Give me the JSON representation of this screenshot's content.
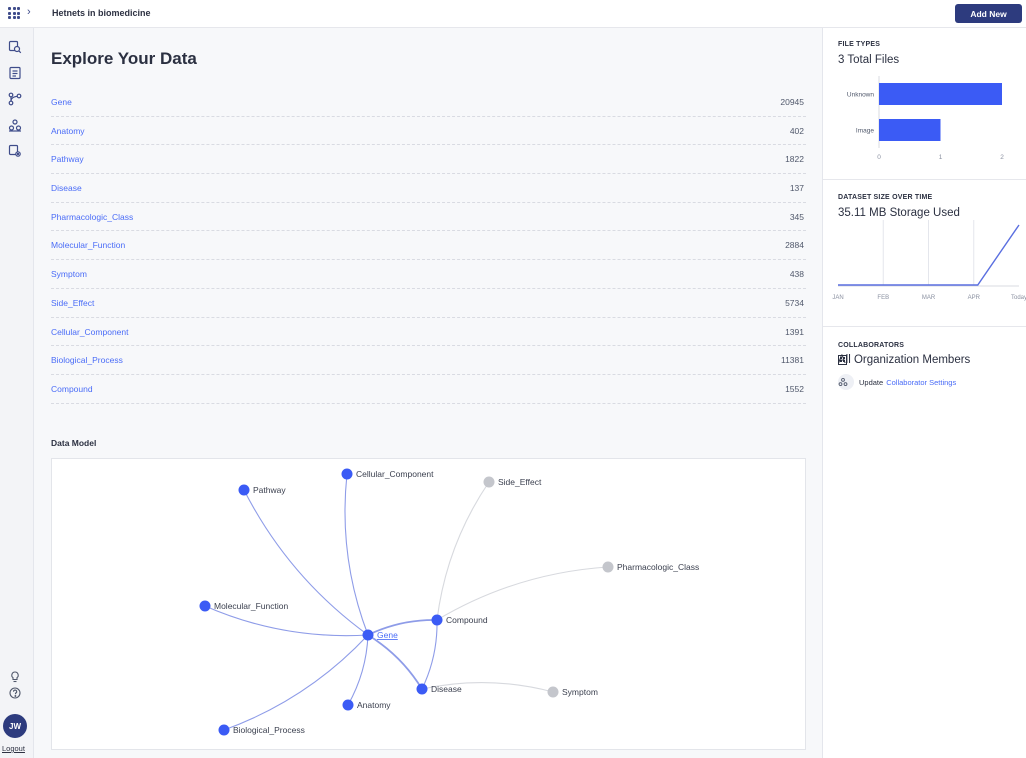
{
  "header": {
    "project_title": "Hetnets in biomedicine",
    "add_new_label": "Add New"
  },
  "rail": {
    "icons": [
      "explore-icon",
      "files-icon",
      "graph-icon",
      "collaborators-icon",
      "settings-icon"
    ],
    "bottom_icons": [
      "lightbulb-icon",
      "help-icon"
    ],
    "user_initials": "JW",
    "logout_label": "Logout"
  },
  "main": {
    "title": "Explore Your Data",
    "rows": [
      {
        "name": "Gene",
        "count": "20945"
      },
      {
        "name": "Anatomy",
        "count": "402"
      },
      {
        "name": "Pathway",
        "count": "1822"
      },
      {
        "name": "Disease",
        "count": "137"
      },
      {
        "name": "Pharmacologic_Class",
        "count": "345"
      },
      {
        "name": "Molecular_Function",
        "count": "2884"
      },
      {
        "name": "Symptom",
        "count": "438"
      },
      {
        "name": "Side_Effect",
        "count": "5734"
      },
      {
        "name": "Cellular_Component",
        "count": "1391"
      },
      {
        "name": "Biological_Process",
        "count": "11381"
      },
      {
        "name": "Compound",
        "count": "1552"
      }
    ],
    "data_model_label": "Data Model",
    "graph": {
      "nodes": [
        {
          "id": "Gene",
          "label": "Gene",
          "color": "#3b5bf5"
        },
        {
          "id": "Pathway",
          "label": "Pathway",
          "color": "#3b5bf5"
        },
        {
          "id": "Cellular_Component",
          "label": "Cellular_Component",
          "color": "#3b5bf5"
        },
        {
          "id": "Side_Effect",
          "label": "Side_Effect",
          "color": "#c4c6cc"
        },
        {
          "id": "Pharmacologic_Class",
          "label": "Pharmacologic_Class",
          "color": "#c4c6cc"
        },
        {
          "id": "Molecular_Function",
          "label": "Molecular_Function",
          "color": "#3b5bf5"
        },
        {
          "id": "Compound",
          "label": "Compound",
          "color": "#3b5bf5"
        },
        {
          "id": "Disease",
          "label": "Disease",
          "color": "#3b5bf5"
        },
        {
          "id": "Symptom",
          "label": "Symptom",
          "color": "#c4c6cc"
        },
        {
          "id": "Anatomy",
          "label": "Anatomy",
          "color": "#3b5bf5"
        },
        {
          "id": "Biological_Process",
          "label": "Biological_Process",
          "color": "#3b5bf5"
        }
      ],
      "edges": [
        [
          "Gene",
          "Pathway"
        ],
        [
          "Gene",
          "Cellular_Component"
        ],
        [
          "Gene",
          "Molecular_Function"
        ],
        [
          "Gene",
          "Compound"
        ],
        [
          "Gene",
          "Disease"
        ],
        [
          "Gene",
          "Anatomy"
        ],
        [
          "Gene",
          "Biological_Process"
        ],
        [
          "Compound",
          "Side_Effect"
        ],
        [
          "Compound",
          "Pharmacologic_Class"
        ],
        [
          "Compound",
          "Disease"
        ],
        [
          "Disease",
          "Symptom"
        ]
      ]
    }
  },
  "side": {
    "file_types": {
      "heading": "FILE TYPES",
      "subtitle": "3 Total Files"
    },
    "dataset_size": {
      "heading": "DATASET SIZE OVER TIME",
      "subtitle": "35.11 MB Storage Used"
    },
    "collaborators": {
      "heading": "COLLABORATORS",
      "subtitle": "All Organization Members",
      "update_prefix": "Update",
      "update_link": "Collaborator Settings"
    }
  },
  "chart_data": [
    {
      "type": "bar",
      "orientation": "horizontal",
      "categories": [
        "Unknown",
        "Image"
      ],
      "values": [
        2,
        1
      ],
      "xlim": [
        0,
        2
      ],
      "xticks": [
        0,
        1,
        2
      ],
      "color": "#3b5bf5"
    },
    {
      "type": "line",
      "x": [
        "JAN",
        "FEB",
        "MAR",
        "APR",
        "Today"
      ],
      "values": [
        0,
        0,
        0,
        0,
        35.11
      ],
      "ylabel": "",
      "color": "#5a6fe0",
      "grid": true
    }
  ]
}
